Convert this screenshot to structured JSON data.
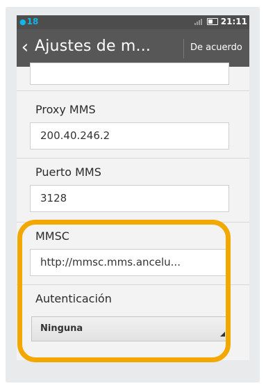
{
  "statusbar": {
    "notification_icon": "firefox-os-icon",
    "notification_count": "18",
    "signal_icon": "signal-icon",
    "battery_icon": "battery-icon",
    "time": "21:11"
  },
  "header": {
    "back_icon": "chevron-left-icon",
    "back_glyph": "‹",
    "title": "Ajustes de m...",
    "done_label": "De acuerdo"
  },
  "fields": {
    "proxy_mms": {
      "label": "Proxy MMS",
      "value": "200.40.246.2"
    },
    "puerto_mms": {
      "label": "Puerto MMS",
      "value": "3128"
    },
    "mmsc": {
      "label": "MMSC",
      "value": "http://mmsc.mms.ancelu..."
    },
    "autenticacion": {
      "label": "Autenticación",
      "selected": "Ninguna"
    }
  },
  "colors": {
    "highlight": "#f2a800",
    "header_bg": "#575757",
    "status_accent": "#11b6e8"
  }
}
